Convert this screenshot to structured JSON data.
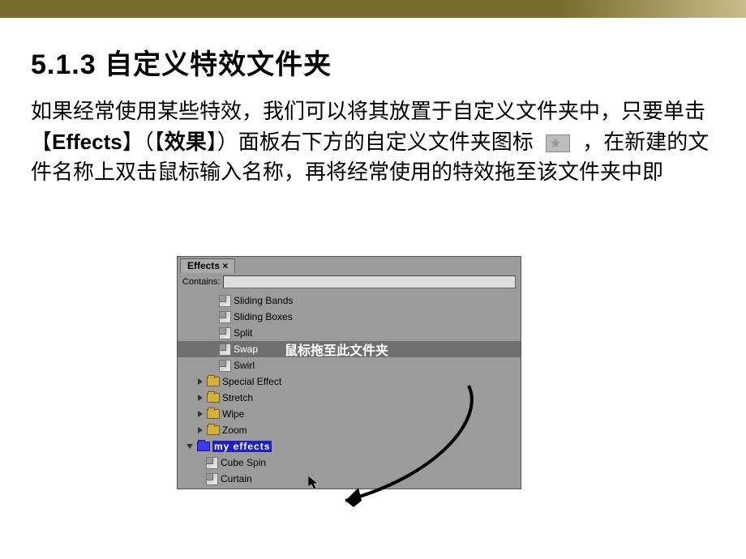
{
  "heading": "5.1.3  自定义特效文件夹",
  "paragraph": {
    "p1": "如果经常使用某些特效，我们可以将其放置于自定义文件夹中，只要单击【",
    "p2_bold_en": "Effects",
    "p3": "】（【",
    "p4_bold_cn": "效果",
    "p5": "】）面板右下方的自定义文件夹图标",
    "p6": "，在新建的文件名称上双击鼠标输入名称，再将经常使用的特效拖至该文件夹中即",
    "p7": ""
  },
  "hint": "鼠标拖至此文件夹",
  "panel": {
    "tab": "Effects",
    "close": "×",
    "contains_label": "Contains:",
    "items": [
      {
        "type": "fx",
        "indent": 40,
        "label": "Sliding Bands"
      },
      {
        "type": "fx",
        "indent": 40,
        "label": "Sliding Boxes"
      },
      {
        "type": "fx",
        "indent": 40,
        "label": "Split"
      },
      {
        "type": "fx",
        "indent": 40,
        "label": "Swap",
        "selected": true
      },
      {
        "type": "fx",
        "indent": 40,
        "label": "Swirl"
      },
      {
        "type": "folder",
        "indent": 12,
        "arrow": "right",
        "label": "Special Effect"
      },
      {
        "type": "folder",
        "indent": 12,
        "arrow": "right",
        "label": "Stretch"
      },
      {
        "type": "folder",
        "indent": 12,
        "arrow": "right",
        "label": "Wipe"
      },
      {
        "type": "folder",
        "indent": 12,
        "arrow": "right",
        "label": "Zoom"
      },
      {
        "type": "folder",
        "indent": 0,
        "arrow": "down",
        "label": "my effects",
        "editing": true,
        "folderSel": true
      },
      {
        "type": "fx",
        "indent": 24,
        "label": "Cube Spin"
      },
      {
        "type": "fx",
        "indent": 24,
        "label": "Curtain"
      }
    ]
  }
}
